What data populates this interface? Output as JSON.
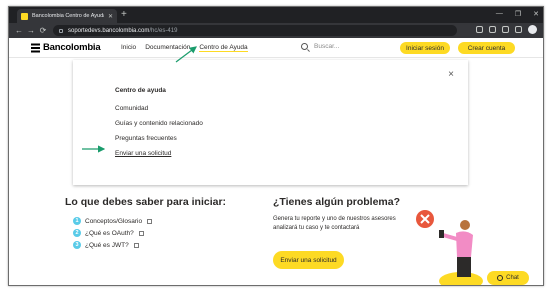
{
  "browser": {
    "tab_title": "Bancolombia Centro de Ayuda | ...",
    "url_host": "soportedevs.bancolombia.com",
    "url_path": "/hc/es-419",
    "new_tab": "+",
    "tab_close": "✕",
    "win_minimize": "—",
    "win_restore": "❐",
    "win_close": "✕",
    "back": "←",
    "forward": "→",
    "reload": "⟳"
  },
  "header": {
    "logo_text": "Bancolombia",
    "nav": [
      "Inicio",
      "Documentación",
      "Centro de Ayuda"
    ],
    "search_placeholder": "Buscar...",
    "login_label": "Iniciar sesión",
    "create_label": "Crear cuenta"
  },
  "dropdown": {
    "close": "×",
    "title": "Centro de ayuda",
    "items": [
      "Comunidad",
      "Guías y contenido relacionado",
      "Preguntas frecuentes",
      "Enviar una solicitud"
    ]
  },
  "learn": {
    "title": "Lo que debes saber para iniciar:",
    "items": [
      {
        "num": "1",
        "label": "Conceptos/Glosario"
      },
      {
        "num": "2",
        "label": "¿Qué es OAuth?"
      },
      {
        "num": "3",
        "label": "¿Qué es JWT?"
      }
    ]
  },
  "problem": {
    "title": "¿Tienes algún problema?",
    "desc": "Genera tu reporte y uno de nuestros asesores analizará tu caso y te contactará",
    "button": "Enviar una solicitud"
  },
  "chat": {
    "label": "Chat"
  },
  "colors": {
    "brand_yellow": "#fdda24",
    "annotation_green": "#1a9c6c",
    "badge_blue": "#59cbe8"
  }
}
